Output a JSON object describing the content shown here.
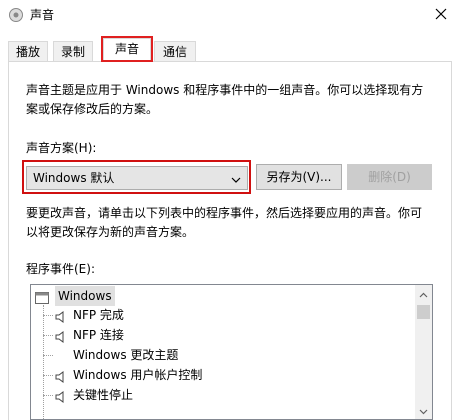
{
  "window": {
    "title": "声音"
  },
  "tabs": [
    {
      "label": "播放"
    },
    {
      "label": "录制"
    },
    {
      "label": "声音"
    },
    {
      "label": "通信"
    }
  ],
  "sounds": {
    "description_line1": "声音主题是应用于 Windows 和程序事件中的一组声音。你可以选择现有方",
    "description_line2": "案或保存修改后的方案。",
    "scheme_label": "声音方案(H):",
    "scheme_value": "Windows 默认",
    "save_as_button": "另存为(V)...",
    "delete_button": "删除(D)",
    "instruction_line1": "要更改声音，请单击以下列表中的程序事件，然后选择要应用的声音。你可",
    "instruction_line2": "以将更改保存为新的声音方案。",
    "events_label": "程序事件(E):",
    "events": [
      {
        "label": "Windows"
      },
      {
        "label": "NFP 完成"
      },
      {
        "label": "NFP 连接"
      },
      {
        "label": "Windows 更改主题"
      },
      {
        "label": "Windows 用户帐户控制"
      },
      {
        "label": "关键性停止"
      }
    ]
  },
  "icons": {
    "title": "speaker-icon",
    "close": "close-icon",
    "dropdown": "chevron-down-icon",
    "group": "window-icon",
    "sound": "speaker-icon"
  }
}
